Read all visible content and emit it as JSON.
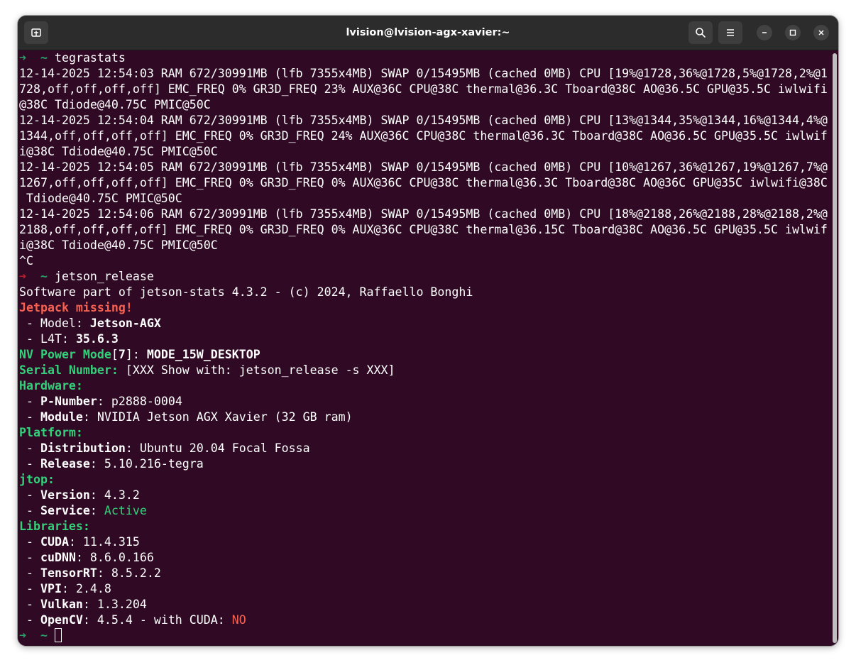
{
  "window": {
    "title": "lvision@lvision-agx-xavier:~"
  },
  "colors": {
    "terminal_bg": "#300a24",
    "prompt_green": "#26a269",
    "prompt_red": "#c01c28",
    "label_green": "#33d17a",
    "alert_red": "#f66151"
  },
  "icons": {
    "new_tab": "new-tab-icon",
    "search": "search-icon",
    "menu": "hamburger-menu-icon",
    "minimize": "minimize-icon",
    "maximize": "maximize-icon",
    "close": "close-icon"
  },
  "terminal": {
    "prompt1": {
      "arrow": "➜",
      "dir": "~",
      "command": "tegrastats"
    },
    "stats": [
      [
        "12-14-2025 12:54:03 RAM 672/30991MB (lfb 7355x4MB) SWAP 0/15495MB (cached 0MB) CPU [19%@1728,36%@1728,5%@1728,2%@1",
        "728,off,off,off,off] EMC_FREQ 0% GR3D_FREQ 23% AUX@36C CPU@38C thermal@36.3C Tboard@38C AO@36.5C GPU@35.5C iwlwifi",
        "@38C Tdiode@40.75C PMIC@50C"
      ],
      [
        "12-14-2025 12:54:04 RAM 672/30991MB (lfb 7355x4MB) SWAP 0/15495MB (cached 0MB) CPU [13%@1344,35%@1344,16%@1344,4%@",
        "1344,off,off,off,off] EMC_FREQ 0% GR3D_FREQ 24% AUX@36C CPU@38C thermal@36.3C Tboard@38C AO@36.5C GPU@35.5C iwlwif",
        "i@38C Tdiode@40.75C PMIC@50C"
      ],
      [
        "12-14-2025 12:54:05 RAM 672/30991MB (lfb 7355x4MB) SWAP 0/15495MB (cached 0MB) CPU [10%@1267,36%@1267,19%@1267,7%@",
        "1267,off,off,off,off] EMC_FREQ 0% GR3D_FREQ 0% AUX@36C CPU@38C thermal@36.3C Tboard@38C AO@36C GPU@35C iwlwifi@38C",
        " Tdiode@40.75C PMIC@50C"
      ],
      [
        "12-14-2025 12:54:06 RAM 672/30991MB (lfb 7355x4MB) SWAP 0/15495MB (cached 0MB) CPU [18%@2188,26%@2188,28%@2188,2%@",
        "2188,off,off,off,off] EMC_FREQ 0% GR3D_FREQ 0% AUX@36C CPU@38C thermal@36.15C Tboard@38C AO@36.5C GPU@35.5C iwlwif",
        "i@38C Tdiode@40.75C PMIC@50C"
      ]
    ],
    "interrupt": "^C",
    "prompt2": {
      "arrow": "➜",
      "dir": "~",
      "command": "jetson_release"
    },
    "software_line": "Software part of jetson-stats 4.3.2 - (c) 2024, Raffaello Bonghi",
    "jetpack_missing": "Jetpack missing!",
    "model": {
      "prefix": " - Model: ",
      "value": "Jetson-AGX"
    },
    "l4t": {
      "prefix": " - L4T: ",
      "value": "35.6.3"
    },
    "power_mode": {
      "label": "NV Power Mode",
      "open": "[",
      "index": "7",
      "close": "]",
      "colon": ": ",
      "value": "MODE_15W_DESKTOP"
    },
    "serial": {
      "label": "Serial Number:",
      "value": " [XXX Show with: jetson_release -s XXX]"
    },
    "hardware": {
      "heading": "Hardware:",
      "items": [
        {
          "key": "P-Number",
          "value": ": p2888-0004"
        },
        {
          "key": "Module",
          "value": ": NVIDIA Jetson AGX Xavier (32 GB ram)"
        }
      ]
    },
    "platform": {
      "heading": "Platform:",
      "items": [
        {
          "key": "Distribution",
          "value": ": Ubuntu 20.04 Focal Fossa"
        },
        {
          "key": "Release",
          "value": ": 5.10.216-tegra"
        }
      ]
    },
    "jtop": {
      "heading": "jtop:",
      "version": {
        "key": "Version",
        "value": ": 4.3.2"
      },
      "service": {
        "key": "Service",
        "sep": ": ",
        "value": "Active"
      }
    },
    "libraries": {
      "heading": "Libraries:",
      "items": [
        {
          "key": "CUDA",
          "value": ": 11.4.315"
        },
        {
          "key": "cuDNN",
          "value": ": 8.6.0.166"
        },
        {
          "key": "TensorRT",
          "value": ": 8.5.2.2"
        },
        {
          "key": "VPI",
          "value": ": 2.4.8"
        },
        {
          "key": "Vulkan",
          "value": ": 1.3.204"
        }
      ],
      "opencv": {
        "key": "OpenCV",
        "value": ": 4.5.4 - with CUDA: ",
        "cuda": "NO"
      }
    },
    "prompt3": {
      "arrow": "➜",
      "dir": "~"
    }
  }
}
